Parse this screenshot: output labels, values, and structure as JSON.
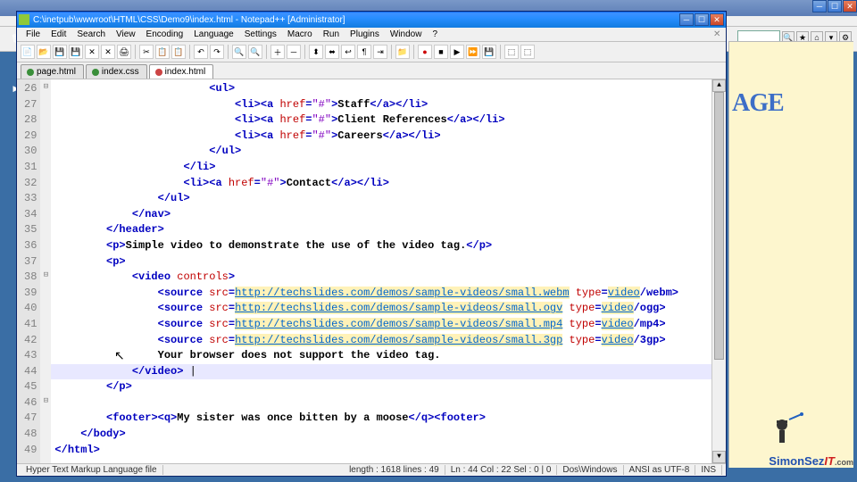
{
  "bg_window": {
    "toolbar_icons": [
      "search",
      "fav",
      "home",
      "feeds",
      "gear"
    ]
  },
  "logo_fragment": "AGE",
  "npp": {
    "title": "C:\\inetpub\\wwwroot\\HTML\\CSS\\Demo9\\index.html - Notepad++ [Administrator]",
    "menus": [
      "File",
      "Edit",
      "Search",
      "View",
      "Encoding",
      "Language",
      "Settings",
      "Macro",
      "Run",
      "Plugins",
      "Window",
      "?"
    ],
    "tabs": [
      {
        "label": "page.html",
        "dirty": false,
        "active": false
      },
      {
        "label": "index.css",
        "dirty": false,
        "active": false
      },
      {
        "label": "index.html",
        "dirty": true,
        "active": true
      }
    ],
    "first_line": 26,
    "fold_markers": {
      "0": "⊟",
      "12": "⊟",
      "20": "⊟",
      "26": "⊟"
    },
    "lines": [
      {
        "indent": 24,
        "tokens": [
          {
            "t": "<",
            "c": "tg"
          },
          {
            "t": "ul",
            "c": "tg"
          },
          {
            "t": ">",
            "c": "tg"
          }
        ]
      },
      {
        "indent": 28,
        "tokens": [
          {
            "t": "<",
            "c": "tg"
          },
          {
            "t": "li",
            "c": "tg"
          },
          {
            "t": "><",
            "c": "tg"
          },
          {
            "t": "a ",
            "c": "tg"
          },
          {
            "t": "href",
            "c": "at"
          },
          {
            "t": "=",
            "c": "tg"
          },
          {
            "t": "\"#\"",
            "c": "st"
          },
          {
            "t": ">",
            "c": "tg"
          },
          {
            "t": "Staff",
            "c": "txt"
          },
          {
            "t": "</",
            "c": "tg"
          },
          {
            "t": "a",
            "c": "tg"
          },
          {
            "t": "></",
            "c": "tg"
          },
          {
            "t": "li",
            "c": "tg"
          },
          {
            "t": ">",
            "c": "tg"
          }
        ]
      },
      {
        "indent": 28,
        "tokens": [
          {
            "t": "<",
            "c": "tg"
          },
          {
            "t": "li",
            "c": "tg"
          },
          {
            "t": "><",
            "c": "tg"
          },
          {
            "t": "a ",
            "c": "tg"
          },
          {
            "t": "href",
            "c": "at"
          },
          {
            "t": "=",
            "c": "tg"
          },
          {
            "t": "\"#\"",
            "c": "st"
          },
          {
            "t": ">",
            "c": "tg"
          },
          {
            "t": "Client References",
            "c": "txt"
          },
          {
            "t": "</",
            "c": "tg"
          },
          {
            "t": "a",
            "c": "tg"
          },
          {
            "t": "></",
            "c": "tg"
          },
          {
            "t": "li",
            "c": "tg"
          },
          {
            "t": ">",
            "c": "tg"
          }
        ]
      },
      {
        "indent": 28,
        "tokens": [
          {
            "t": "<",
            "c": "tg"
          },
          {
            "t": "li",
            "c": "tg"
          },
          {
            "t": "><",
            "c": "tg"
          },
          {
            "t": "a ",
            "c": "tg"
          },
          {
            "t": "href",
            "c": "at"
          },
          {
            "t": "=",
            "c": "tg"
          },
          {
            "t": "\"#\"",
            "c": "st"
          },
          {
            "t": ">",
            "c": "tg"
          },
          {
            "t": "Careers",
            "c": "txt"
          },
          {
            "t": "</",
            "c": "tg"
          },
          {
            "t": "a",
            "c": "tg"
          },
          {
            "t": "></",
            "c": "tg"
          },
          {
            "t": "li",
            "c": "tg"
          },
          {
            "t": ">",
            "c": "tg"
          }
        ]
      },
      {
        "indent": 24,
        "tokens": [
          {
            "t": "</",
            "c": "tg"
          },
          {
            "t": "ul",
            "c": "tg"
          },
          {
            "t": ">",
            "c": "tg"
          }
        ]
      },
      {
        "indent": 20,
        "tokens": [
          {
            "t": "</",
            "c": "tg"
          },
          {
            "t": "li",
            "c": "tg"
          },
          {
            "t": ">",
            "c": "tg"
          }
        ]
      },
      {
        "indent": 20,
        "tokens": [
          {
            "t": "<",
            "c": "tg"
          },
          {
            "t": "li",
            "c": "tg"
          },
          {
            "t": "><",
            "c": "tg"
          },
          {
            "t": "a ",
            "c": "tg"
          },
          {
            "t": "href",
            "c": "at"
          },
          {
            "t": "=",
            "c": "tg"
          },
          {
            "t": "\"#\"",
            "c": "st"
          },
          {
            "t": ">",
            "c": "tg"
          },
          {
            "t": "Contact",
            "c": "txt"
          },
          {
            "t": "</",
            "c": "tg"
          },
          {
            "t": "a",
            "c": "tg"
          },
          {
            "t": "></",
            "c": "tg"
          },
          {
            "t": "li",
            "c": "tg"
          },
          {
            "t": ">",
            "c": "tg"
          }
        ]
      },
      {
        "indent": 16,
        "tokens": [
          {
            "t": "</",
            "c": "tg"
          },
          {
            "t": "ul",
            "c": "tg"
          },
          {
            "t": ">",
            "c": "tg"
          }
        ]
      },
      {
        "indent": 12,
        "tokens": [
          {
            "t": "</",
            "c": "tg"
          },
          {
            "t": "nav",
            "c": "tg"
          },
          {
            "t": ">",
            "c": "tg"
          }
        ]
      },
      {
        "indent": 8,
        "tokens": [
          {
            "t": "</",
            "c": "tg"
          },
          {
            "t": "header",
            "c": "tg"
          },
          {
            "t": ">",
            "c": "tg"
          }
        ]
      },
      {
        "indent": 8,
        "tokens": [
          {
            "t": "<",
            "c": "tg"
          },
          {
            "t": "p",
            "c": "tg"
          },
          {
            "t": ">",
            "c": "tg"
          },
          {
            "t": "Simple video to demonstrate the use of the video tag.",
            "c": "txt"
          },
          {
            "t": "</",
            "c": "tg"
          },
          {
            "t": "p",
            "c": "tg"
          },
          {
            "t": ">",
            "c": "tg"
          }
        ]
      },
      {
        "indent": 8,
        "tokens": [
          {
            "t": "<",
            "c": "tg"
          },
          {
            "t": "p",
            "c": "tg"
          },
          {
            "t": ">",
            "c": "tg"
          }
        ]
      },
      {
        "indent": 12,
        "tokens": [
          {
            "t": "<",
            "c": "tg"
          },
          {
            "t": "video ",
            "c": "tg"
          },
          {
            "t": "controls",
            "c": "at"
          },
          {
            "t": ">",
            "c": "tg"
          }
        ]
      },
      {
        "indent": 16,
        "tokens": [
          {
            "t": "<",
            "c": "tg"
          },
          {
            "t": "source ",
            "c": "tg"
          },
          {
            "t": "src",
            "c": "at"
          },
          {
            "t": "=",
            "c": "tg"
          },
          {
            "t": "http://techslides.com/demos/sample-videos/small.webm",
            "c": "url"
          },
          {
            "t": " ",
            "c": ""
          },
          {
            "t": "type",
            "c": "at"
          },
          {
            "t": "=",
            "c": "tg"
          },
          {
            "t": "video",
            "c": "url"
          },
          {
            "t": "/webm>",
            "c": "tg"
          }
        ]
      },
      {
        "indent": 16,
        "tokens": [
          {
            "t": "<",
            "c": "tg"
          },
          {
            "t": "source ",
            "c": "tg"
          },
          {
            "t": "src",
            "c": "at"
          },
          {
            "t": "=",
            "c": "tg"
          },
          {
            "t": "http://techslides.com/demos/sample-videos/small.ogv",
            "c": "url"
          },
          {
            "t": " ",
            "c": ""
          },
          {
            "t": "type",
            "c": "at"
          },
          {
            "t": "=",
            "c": "tg"
          },
          {
            "t": "video",
            "c": "url"
          },
          {
            "t": "/ogg>",
            "c": "tg"
          }
        ]
      },
      {
        "indent": 16,
        "tokens": [
          {
            "t": "<",
            "c": "tg"
          },
          {
            "t": "source ",
            "c": "tg"
          },
          {
            "t": "src",
            "c": "at"
          },
          {
            "t": "=",
            "c": "tg"
          },
          {
            "t": "http://techslides.com/demos/sample-videos/small.mp4",
            "c": "url"
          },
          {
            "t": " ",
            "c": ""
          },
          {
            "t": "type",
            "c": "at"
          },
          {
            "t": "=",
            "c": "tg"
          },
          {
            "t": "video",
            "c": "url"
          },
          {
            "t": "/mp4>",
            "c": "tg"
          }
        ]
      },
      {
        "indent": 16,
        "tokens": [
          {
            "t": "<",
            "c": "tg"
          },
          {
            "t": "source ",
            "c": "tg"
          },
          {
            "t": "src",
            "c": "at"
          },
          {
            "t": "=",
            "c": "tg"
          },
          {
            "t": "http://techslides.com/demos/sample-videos/small.3gp",
            "c": "url"
          },
          {
            "t": " ",
            "c": ""
          },
          {
            "t": "type",
            "c": "at"
          },
          {
            "t": "=",
            "c": "tg"
          },
          {
            "t": "video",
            "c": "url"
          },
          {
            "t": "/3gp>",
            "c": "tg"
          }
        ]
      },
      {
        "indent": 16,
        "tokens": [
          {
            "t": "Your browser does not support the video tag.",
            "c": "txt"
          }
        ]
      },
      {
        "indent": 12,
        "tokens": [
          {
            "t": "</",
            "c": "tg"
          },
          {
            "t": "video",
            "c": "tg"
          },
          {
            "t": "> ",
            "c": "tg"
          },
          {
            "t": "|",
            "c": ""
          }
        ],
        "hl": true
      },
      {
        "indent": 8,
        "tokens": [
          {
            "t": "</",
            "c": "tg"
          },
          {
            "t": "p",
            "c": "tg"
          },
          {
            "t": ">",
            "c": "tg"
          }
        ]
      },
      {
        "indent": 0,
        "tokens": []
      },
      {
        "indent": 8,
        "tokens": [
          {
            "t": "<",
            "c": "tg"
          },
          {
            "t": "footer",
            "c": "tg"
          },
          {
            "t": "><",
            "c": "tg"
          },
          {
            "t": "q",
            "c": "tg"
          },
          {
            "t": ">",
            "c": "tg"
          },
          {
            "t": "My sister was once bitten by a moose",
            "c": "txt"
          },
          {
            "t": "</",
            "c": "tg"
          },
          {
            "t": "q",
            "c": "tg"
          },
          {
            "t": "><",
            "c": "tg"
          },
          {
            "t": "footer",
            "c": "tg"
          },
          {
            "t": ">",
            "c": "tg"
          }
        ]
      },
      {
        "indent": 4,
        "tokens": [
          {
            "t": "</",
            "c": "tg"
          },
          {
            "t": "body",
            "c": "tg"
          },
          {
            "t": ">",
            "c": "tg"
          }
        ]
      },
      {
        "indent": 0,
        "tokens": [
          {
            "t": "</",
            "c": "tg"
          },
          {
            "t": "html",
            "c": "tg"
          },
          {
            "t": ">",
            "c": "tg"
          }
        ]
      }
    ],
    "status": {
      "filetype": "Hyper Text Markup Language file",
      "length": "length : 1618   lines : 49",
      "pos": "Ln : 44   Col : 22   Sel : 0 | 0",
      "eol": "Dos\\Windows",
      "enc": "ANSI as UTF-8",
      "ovr": "INS"
    }
  },
  "watermark": {
    "brand": "SimonSez",
    "suffix": "IT",
    "tld": ".com"
  },
  "colors": {
    "url_bg": "#fff2b8",
    "hl": "#e8e8ff",
    "tag": "#0000c0",
    "attr": "#c00000",
    "str": "#8000c0"
  }
}
